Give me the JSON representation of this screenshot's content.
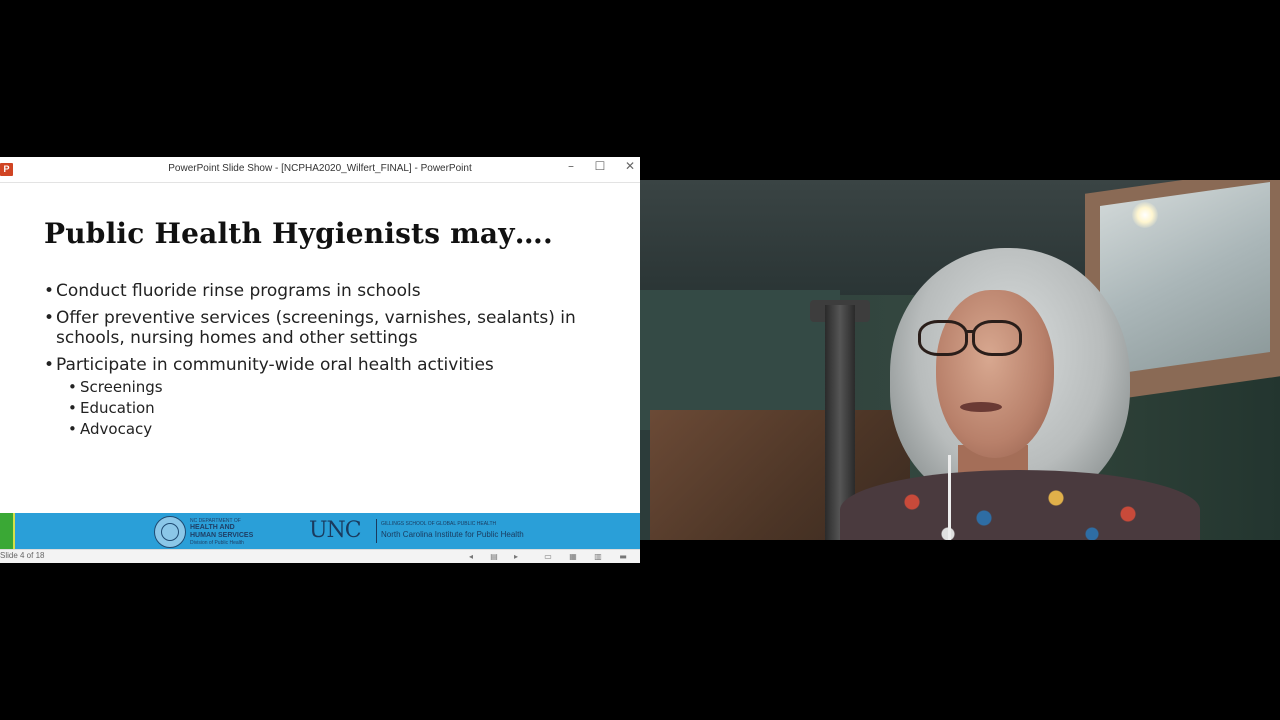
{
  "window": {
    "title": "PowerPoint Slide Show - [NCPHA2020_Wilfert_FINAL] - PowerPoint",
    "app_icon": "powerpoint-icon",
    "controls": {
      "minimize": "–",
      "maximize": "☐",
      "close": "✕"
    }
  },
  "slide": {
    "title": "Public Health Hygienists may….",
    "bullets": [
      "Conduct fluoride rinse programs in schools",
      "Offer preventive services (screenings, varnishes, sealants) in schools, nursing homes and other settings",
      "Participate in community-wide oral health activities"
    ],
    "sub_bullets": [
      "Screenings",
      "Education",
      "Advocacy"
    ],
    "footer": {
      "dhhs_line1": "NC DEPARTMENT OF",
      "dhhs_line2": "HEALTH AND HUMAN SERVICES",
      "dhhs_line3": "Division of Public Health",
      "unc_logo": "UNC",
      "unc_sub": "GILLINGS SCHOOL OF GLOBAL PUBLIC HEALTH",
      "unc_name": "North Carolina Institute for Public Health"
    },
    "colors": {
      "footer_blue": "#2a9fd8",
      "footer_green": "#3aa835"
    }
  },
  "statusbar": {
    "slide_count": "Slide 4 of 18",
    "icons": [
      "prev-icon",
      "menu-icon",
      "next-icon",
      "normal-view-icon",
      "slide-sorter-icon",
      "reading-view-icon",
      "slideshow-icon"
    ]
  },
  "webcam": {
    "description_icon": "webcam-feed"
  }
}
